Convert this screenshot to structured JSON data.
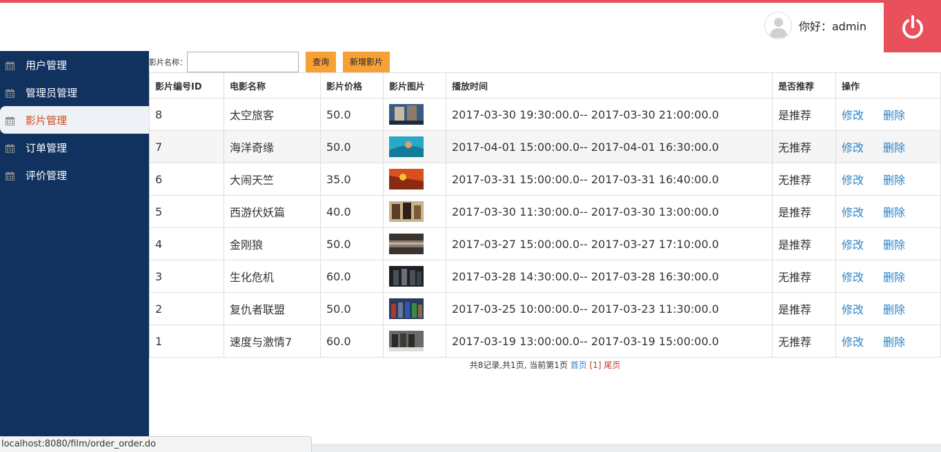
{
  "header": {
    "greeting": "你好：admin"
  },
  "sidebar": {
    "items": [
      {
        "label": "用户管理"
      },
      {
        "label": "管理员管理"
      },
      {
        "label": "影片管理"
      },
      {
        "label": "订单管理"
      },
      {
        "label": "评价管理"
      }
    ]
  },
  "search": {
    "label": "影片名称：",
    "value": "",
    "query_label": "查询",
    "add_label": "新增影片"
  },
  "table": {
    "headers": [
      "影片编号ID",
      "电影名称",
      "影片价格",
      "影片图片",
      "播放时间",
      "是否推荐",
      "操作"
    ],
    "rows": [
      {
        "id": "8",
        "name": "太空旅客",
        "price": "50.0",
        "time": "2017-03-30 19:30:00.0-- 2017-03-30 21:00:00.0",
        "rec": "是推荐",
        "edit": "修改",
        "del": "删除"
      },
      {
        "id": "7",
        "name": "海洋奇缘",
        "price": "50.0",
        "time": "2017-04-01 15:00:00.0-- 2017-04-01 16:30:00.0",
        "rec": "无推荐",
        "edit": "修改",
        "del": "删除"
      },
      {
        "id": "6",
        "name": "大闹天竺",
        "price": "35.0",
        "time": "2017-03-31 15:00:00.0-- 2017-03-31 16:40:00.0",
        "rec": "无推荐",
        "edit": "修改",
        "del": "删除"
      },
      {
        "id": "5",
        "name": "西游伏妖篇",
        "price": "40.0",
        "time": "2017-03-30 11:30:00.0-- 2017-03-30 13:00:00.0",
        "rec": "是推荐",
        "edit": "修改",
        "del": "删除"
      },
      {
        "id": "4",
        "name": "金刚狼",
        "price": "50.0",
        "time": "2017-03-27 15:00:00.0-- 2017-03-27 17:10:00.0",
        "rec": "是推荐",
        "edit": "修改",
        "del": "删除"
      },
      {
        "id": "3",
        "name": "生化危机",
        "price": "60.0",
        "time": "2017-03-28 14:30:00.0-- 2017-03-28 16:30:00.0",
        "rec": "无推荐",
        "edit": "修改",
        "del": "删除"
      },
      {
        "id": "2",
        "name": "复仇者联盟",
        "price": "50.0",
        "time": "2017-03-25 10:00:00.0-- 2017-03-23 11:30:00.0",
        "rec": "是推荐",
        "edit": "修改",
        "del": "删除"
      },
      {
        "id": "1",
        "name": "速度与激情7",
        "price": "60.0",
        "time": "2017-03-19 13:00:00.0-- 2017-03-19 15:00:00.0",
        "rec": "无推荐",
        "edit": "修改",
        "del": "删除"
      }
    ]
  },
  "pager": {
    "summary": "共8记录,共1页, 当前第1页",
    "first": "首页",
    "current": "[1]",
    "last": "尾页"
  },
  "statusbar": {
    "url": "localhost:8080/film/order_order.do"
  },
  "colors": {
    "accent": "#e8505b",
    "sidebar": "#11325f",
    "button": "#f7a035",
    "link": "#2c84c7"
  }
}
